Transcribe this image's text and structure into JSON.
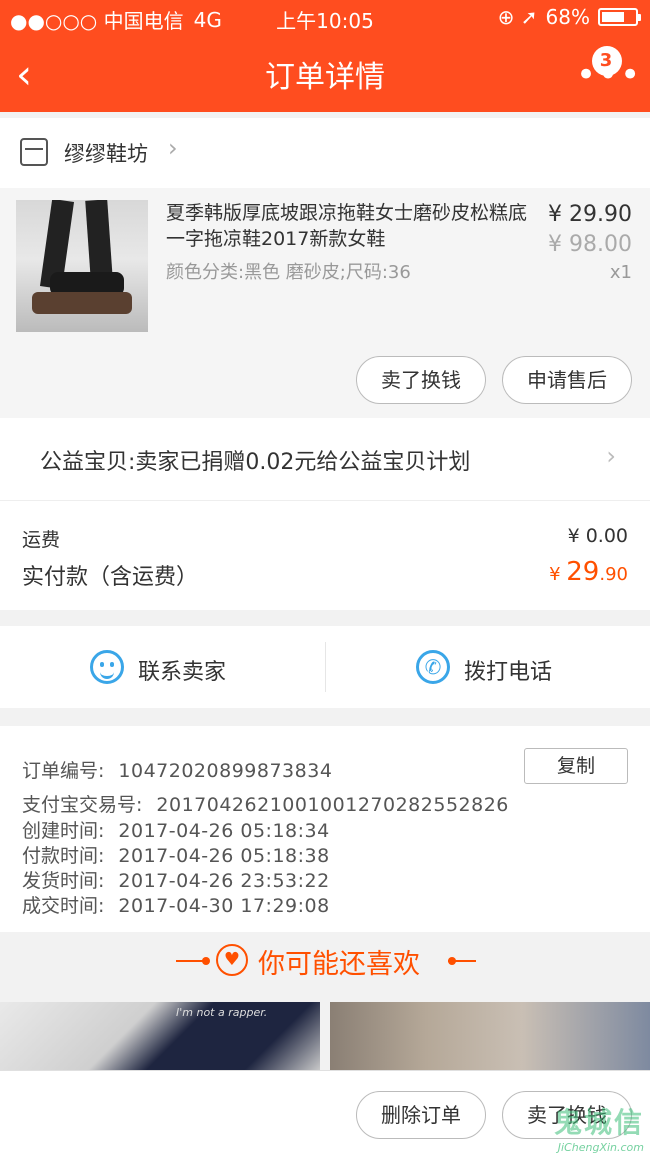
{
  "status_bar": {
    "carrier": "●●○○○ 中国电信",
    "network": "4G",
    "time": "上午10:05",
    "icons": "⊕ ➚",
    "battery": "68%"
  },
  "nav": {
    "back_icon": "‹",
    "title": "订单详情",
    "more_icon": "•••",
    "badge": "3"
  },
  "shop": {
    "name": "缪缪鞋坊",
    "arrow": "›"
  },
  "product": {
    "title": "夏季韩版厚底坡跟凉拖鞋女士磨砂皮松糕底一字拖凉鞋2017新款女鞋",
    "sku": "颜色分类:黑色 磨砂皮;尺码:36",
    "price": "¥ 29.90",
    "original_price": "¥ 98.00",
    "quantity": "x1",
    "sell_button": "卖了换钱",
    "after_sale_button": "申请售后"
  },
  "charity": {
    "text": "公益宝贝:卖家已捐赠0.02元给公益宝贝计划",
    "arrow": "›"
  },
  "fees": {
    "shipping_label": "运费",
    "shipping_value": "¥ 0.00",
    "paid_label": "实付款（含运费）",
    "paid_currency": "¥ ",
    "paid_int": "29",
    "paid_dec": ".90"
  },
  "contact": {
    "seller_label": "联系卖家",
    "phone_label": "拨打电话",
    "phone_icon": "✆"
  },
  "order_info": {
    "order_no_label": "订单编号:",
    "order_no": "1047202089987383​4",
    "copy_button": "复制",
    "alipay_label": "支付宝交易号:",
    "alipay_no": "20170426210010012702825528​26",
    "created_label": "创建时间:",
    "created": "2017-04-26 05:18:34",
    "paid_label": "付款时间:",
    "paid": "2017-04-26 05:18:38",
    "shipped_label": "发货时间:",
    "shipped": "2017-04-26 23:53:22",
    "completed_label": "成交时间:",
    "completed": "2017-04-30 17:29:08"
  },
  "recommend": {
    "title": "你可能还喜欢",
    "heart_icon": "♥",
    "photo1_text": "I'm not a rapper."
  },
  "bottom": {
    "delete_button": "删除订单",
    "sell_button": "卖了换钱"
  },
  "watermark": {
    "main": "鬼城信",
    "sub": "JiChengXin.com"
  },
  "colors": {
    "brand": "#ff4d1f",
    "accent": "#ff5000",
    "contact_icon": "#3aa6e8"
  }
}
